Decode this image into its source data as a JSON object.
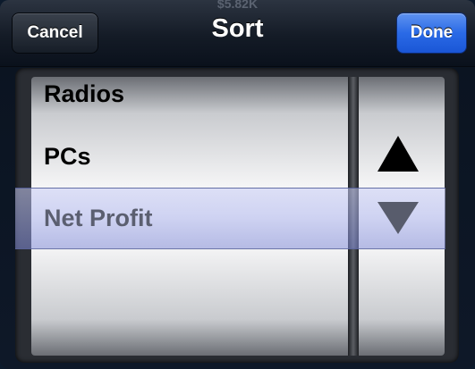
{
  "navbar": {
    "title": "Sort",
    "cancel_label": "Cancel",
    "done_label": "Done",
    "background_text": "$5.82K"
  },
  "picker": {
    "field_options": [
      "Radios",
      "PCs",
      "Net Profit"
    ],
    "selected_field": "Net Profit",
    "direction_options": [
      "ascending",
      "descending"
    ],
    "selected_direction": "descending"
  },
  "colors": {
    "accent": "#2a6ae6",
    "selection": "#a8b0e8"
  }
}
